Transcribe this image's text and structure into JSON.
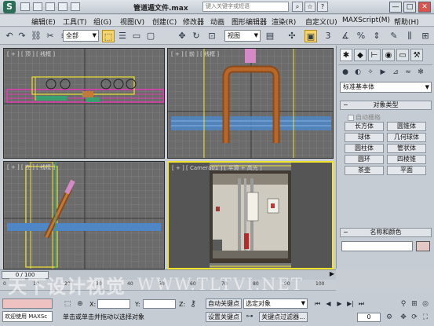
{
  "window": {
    "title": "管道遁文件.max",
    "search_placeholder": "键入关键字或短语",
    "controls": {
      "minimize": "—",
      "maximize": "□",
      "close": "✕"
    }
  },
  "menu": [
    "编辑(E)",
    "工具(T)",
    "组(G)",
    "视图(V)",
    "创建(C)",
    "修改器",
    "动画",
    "图形编辑器",
    "渲染(R)",
    "自定义(U)",
    "MAXScript(M)",
    "帮助(H)"
  ],
  "toolbar": {
    "filter_value": "全部",
    "coord_value": "视图",
    "snap_value": "3",
    "icons": [
      "undo-icon",
      "redo-icon",
      "link-icon",
      "unlink-icon",
      "bind-icon",
      "filter-dropdown",
      "select-icon",
      "select-name-icon",
      "rect-select-icon",
      "window-cross-icon",
      "move-icon",
      "rotate-icon",
      "scale-icon"
    ]
  },
  "viewports": {
    "top": {
      "label": "[ + ] [ 顶 ] [ 线框 ]"
    },
    "front": {
      "label": "[ + ] [ 前 ] [ 线框 ]"
    },
    "left": {
      "label": "[ + ] [ 左 ] [ 线框 ]"
    },
    "camera": {
      "label": "[ + ] [ Camera01 ] [ 平滑 + 高光 ]"
    }
  },
  "command_panel": {
    "category": "标准基本体",
    "object_type_title": "对象类型",
    "autogrid_label": "自动栅格",
    "object_buttons": [
      "长方体",
      "圆锥体",
      "球体",
      "几何球体",
      "圆柱体",
      "管状体",
      "圆环",
      "四棱锥",
      "茶壶",
      "平面"
    ],
    "name_color_title": "名称和颜色",
    "name_value": "",
    "object_color": "#e2c9c3"
  },
  "timeline": {
    "slider_text": "0 / 100",
    "ticks": [
      "0",
      "10",
      "20",
      "30",
      "40",
      "50",
      "60",
      "70",
      "80",
      "90",
      "100"
    ]
  },
  "status": {
    "welcome": "欢迎使用 MAXSc",
    "prompt": "单击或单击并拖动以选择对象",
    "x_label": "X:",
    "y_label": "Y:",
    "z_label": "Z:",
    "auto_key": "自动关键点",
    "set_key": "设置关键点",
    "selection_value": "选定对象",
    "key_filters": "关键点过滤器...",
    "frame_value": "0"
  },
  "watermark": {
    "line1": "天下设计视觉",
    "line2": "WWW.TLTVI.NET"
  }
}
